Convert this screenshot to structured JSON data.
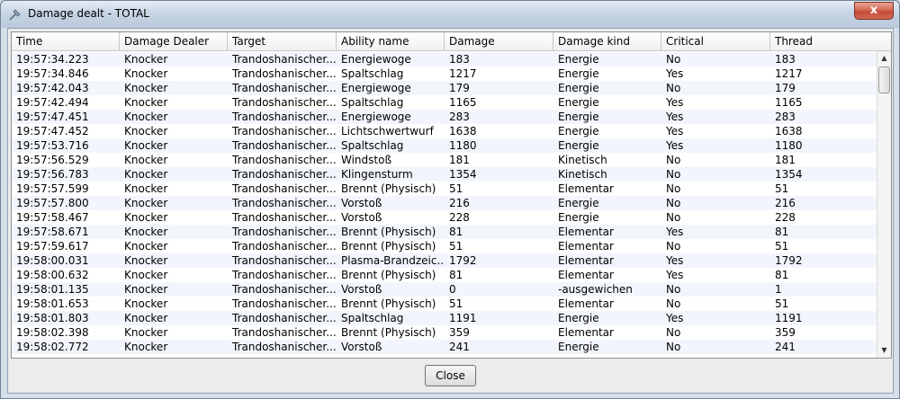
{
  "window": {
    "title": "Damage dealt - TOTAL",
    "close_glyph": "x"
  },
  "table": {
    "columns": [
      "Time",
      "Damage Dealer",
      "Target",
      "Ability name",
      "Damage",
      "Damage kind",
      "Critical",
      "Thread"
    ],
    "rows": [
      [
        "19:57:34.223",
        "Knocker",
        "Trandoshanischer...",
        "Energiewoge",
        "183",
        "Energie",
        "No",
        "183"
      ],
      [
        "19:57:34.846",
        "Knocker",
        "Trandoshanischer...",
        "Spaltschlag",
        "1217",
        "Energie",
        "Yes",
        "1217"
      ],
      [
        "19:57:42.043",
        "Knocker",
        "Trandoshanischer...",
        "Energiewoge",
        "179",
        "Energie",
        "No",
        "179"
      ],
      [
        "19:57:42.494",
        "Knocker",
        "Trandoshanischer...",
        "Spaltschlag",
        "1165",
        "Energie",
        "Yes",
        "1165"
      ],
      [
        "19:57:47.451",
        "Knocker",
        "Trandoshanischer...",
        "Energiewoge",
        "283",
        "Energie",
        "Yes",
        "283"
      ],
      [
        "19:57:47.452",
        "Knocker",
        "Trandoshanischer...",
        "Lichtschwertwurf",
        "1638",
        "Energie",
        "Yes",
        "1638"
      ],
      [
        "19:57:53.716",
        "Knocker",
        "Trandoshanischer...",
        "Spaltschlag",
        "1180",
        "Energie",
        "Yes",
        "1180"
      ],
      [
        "19:57:56.529",
        "Knocker",
        "Trandoshanischer...",
        "Windstoß",
        "181",
        "Kinetisch",
        "No",
        "181"
      ],
      [
        "19:57:56.783",
        "Knocker",
        "Trandoshanischer...",
        "Klingensturm",
        "1354",
        "Kinetisch",
        "No",
        "1354"
      ],
      [
        "19:57:57.599",
        "Knocker",
        "Trandoshanischer...",
        "Brennt (Physisch)",
        "51",
        "Elementar",
        "No",
        "51"
      ],
      [
        "19:57:57.800",
        "Knocker",
        "Trandoshanischer...",
        "Vorstoß",
        "216",
        "Energie",
        "No",
        "216"
      ],
      [
        "19:57:58.467",
        "Knocker",
        "Trandoshanischer...",
        "Vorstoß",
        "228",
        "Energie",
        "No",
        "228"
      ],
      [
        "19:57:58.671",
        "Knocker",
        "Trandoshanischer...",
        "Brennt (Physisch)",
        "81",
        "Elementar",
        "Yes",
        "81"
      ],
      [
        "19:57:59.617",
        "Knocker",
        "Trandoshanischer...",
        "Brennt (Physisch)",
        "51",
        "Elementar",
        "No",
        "51"
      ],
      [
        "19:58:00.031",
        "Knocker",
        "Trandoshanischer...",
        "Plasma-Brandzeic...",
        "1792",
        "Elementar",
        "Yes",
        "1792"
      ],
      [
        "19:58:00.632",
        "Knocker",
        "Trandoshanischer...",
        "Brennt (Physisch)",
        "81",
        "Elementar",
        "Yes",
        "81"
      ],
      [
        "19:58:01.135",
        "Knocker",
        "Trandoshanischer...",
        "Vorstoß",
        "0",
        "-ausgewichen",
        "No",
        "1"
      ],
      [
        "19:58:01.653",
        "Knocker",
        "Trandoshanischer...",
        "Brennt (Physisch)",
        "51",
        "Elementar",
        "No",
        "51"
      ],
      [
        "19:58:01.803",
        "Knocker",
        "Trandoshanischer...",
        "Spaltschlag",
        "1191",
        "Energie",
        "Yes",
        "1191"
      ],
      [
        "19:58:02.398",
        "Knocker",
        "Trandoshanischer...",
        "Brennt (Physisch)",
        "359",
        "Elementar",
        "No",
        "359"
      ],
      [
        "19:58:02.772",
        "Knocker",
        "Trandoshanischer...",
        "Vorstoß",
        "241",
        "Energie",
        "No",
        "241"
      ]
    ]
  },
  "scrollbar": {
    "up_glyph": "▲",
    "down_glyph": "▼"
  },
  "footer": {
    "close_label": "Close"
  },
  "colors": {
    "row_alt": "#f2f6fc",
    "row": "#ffffff"
  }
}
